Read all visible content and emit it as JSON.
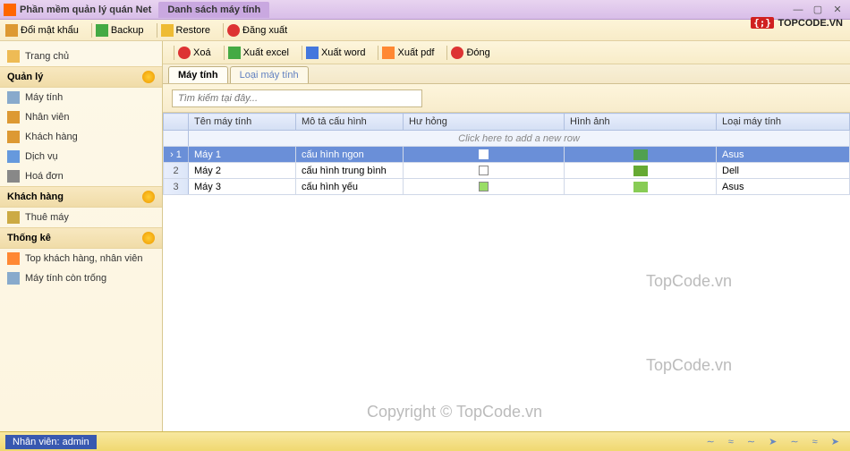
{
  "titlebar": {
    "app": "Phần mềm quản lý quán Net",
    "activeTab": "Danh sách máy tính"
  },
  "menubar": {
    "changepw": "Đổi mật khẩu",
    "backup": "Backup",
    "restore": "Restore",
    "logout": "Đăng xuất"
  },
  "logo": {
    "brace": "{;}",
    "text": "TOPCODE.VN"
  },
  "sidebar": {
    "home": "Trang chủ",
    "manage": "Quản lý",
    "items1": [
      "Máy tính",
      "Nhân viên",
      "Khách hàng",
      "Dịch vụ",
      "Hoá đơn"
    ],
    "customer": "Khách hàng",
    "items2": [
      "Thuê máy"
    ],
    "stats": "Thống kê",
    "items3": [
      "Top khách hàng, nhân viên",
      "Máy tính còn trống"
    ]
  },
  "toolbar": {
    "delete": "Xoá",
    "excel": "Xuất excel",
    "word": "Xuất word",
    "pdf": "Xuất pdf",
    "close": "Đóng"
  },
  "tabs": {
    "t1": "Máy tính",
    "t2": "Loại máy tính"
  },
  "search": {
    "placeholder": "Tìm kiếm tại đây..."
  },
  "grid": {
    "cols": {
      "c1": "Tên máy tính",
      "c2": "Mô tả cấu hình",
      "c3": "Hư hỏng",
      "c4": "Hình ảnh",
      "c5": "Loại máy tính"
    },
    "addrow": "Click here to add a new row",
    "rows": [
      {
        "n": "1",
        "name": "Máy 1",
        "desc": "cấu hình ngon",
        "type": "Asus"
      },
      {
        "n": "2",
        "name": "Máy 2",
        "desc": "cấu hình trung bình",
        "type": "Dell"
      },
      {
        "n": "3",
        "name": "Máy 3",
        "desc": "cấu hình yếu",
        "type": "Asus"
      }
    ]
  },
  "status": {
    "user": "Nhân viên: admin"
  },
  "watermark": {
    "w": "TopCode.vn",
    "c": "Copyright © TopCode.vn"
  }
}
